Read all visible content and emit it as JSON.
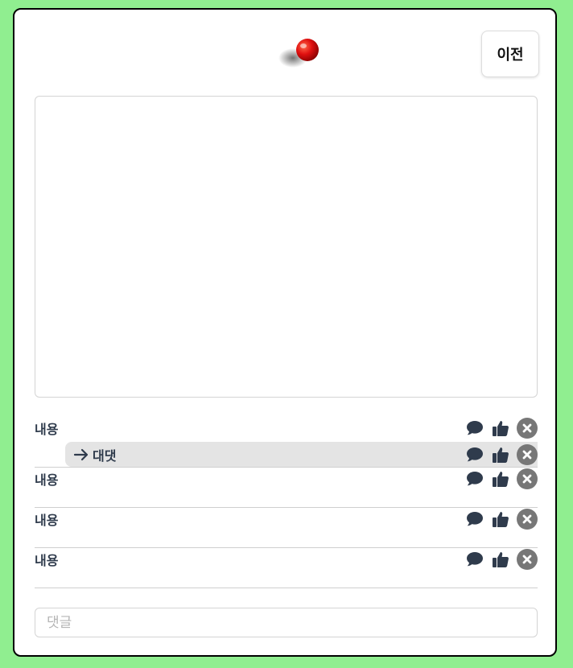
{
  "header": {
    "back_label": "이전",
    "pin_icon": "pushpin-icon"
  },
  "comments": [
    {
      "text": "내용",
      "replies": [
        {
          "text": "대댓"
        }
      ]
    },
    {
      "text": "내용",
      "replies": []
    },
    {
      "text": "내용",
      "replies": []
    },
    {
      "text": "내용",
      "replies": []
    }
  ],
  "icons": {
    "reply": "speech-bubble-icon",
    "like": "thumbs-up-icon",
    "delete": "close-circle-icon",
    "reply_arrow": "arrow-right-icon"
  },
  "colors": {
    "background": "#90ee90",
    "text": "#2f3b4c",
    "reply_bg": "#e4e4e4",
    "delete_bg": "#777777"
  },
  "input": {
    "placeholder": "댓글",
    "value": ""
  }
}
